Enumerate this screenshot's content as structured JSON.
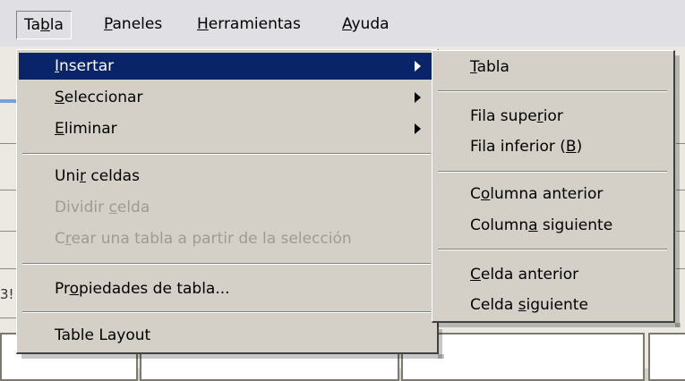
{
  "menubar": {
    "items": [
      {
        "pre": "Ta",
        "acc": "b",
        "post": "la"
      },
      {
        "pre": "",
        "acc": "P",
        "post": "aneles"
      },
      {
        "pre": "",
        "acc": "H",
        "post": "erramientas"
      },
      {
        "pre": "",
        "acc": "A",
        "post": "yuda"
      }
    ]
  },
  "tabla_menu": {
    "items": [
      {
        "pre": "",
        "acc": "I",
        "post": "nsertar"
      },
      {
        "pre": "",
        "acc": "S",
        "post": "eleccionar"
      },
      {
        "pre": "",
        "acc": "E",
        "post": "liminar"
      },
      {
        "pre": "Uni",
        "acc": "r",
        "post": " celdas"
      },
      {
        "pre": "Dividir ",
        "acc": "c",
        "post": "elda"
      },
      {
        "pre": "C",
        "acc": "r",
        "post": "ear una tabla a partir de la selección"
      },
      {
        "pre": "Pr",
        "acc": "o",
        "post": "piedades de tabla..."
      },
      {
        "pre": "Table Layout",
        "acc": "",
        "post": ""
      }
    ]
  },
  "insertar_submenu": {
    "items": [
      {
        "pre": "",
        "acc": "T",
        "post": "abla"
      },
      {
        "pre": "Fila supe",
        "acc": "r",
        "post": "ior"
      },
      {
        "pre": "Fila inferior (",
        "acc": "B",
        "post": ")"
      },
      {
        "pre": "C",
        "acc": "o",
        "post": "lumna anterior"
      },
      {
        "pre": "Column",
        "acc": "a",
        "post": " siguiente"
      },
      {
        "pre": "",
        "acc": "C",
        "post": "elda anterior"
      },
      {
        "pre": "Celda ",
        "acc": "s",
        "post": "iguiente"
      }
    ]
  },
  "background": {
    "fragment": "3!"
  },
  "colors": {
    "highlight": "#0a246a",
    "menu_bg": "#d4d0c8",
    "disabled_text": "#9c9b96"
  }
}
